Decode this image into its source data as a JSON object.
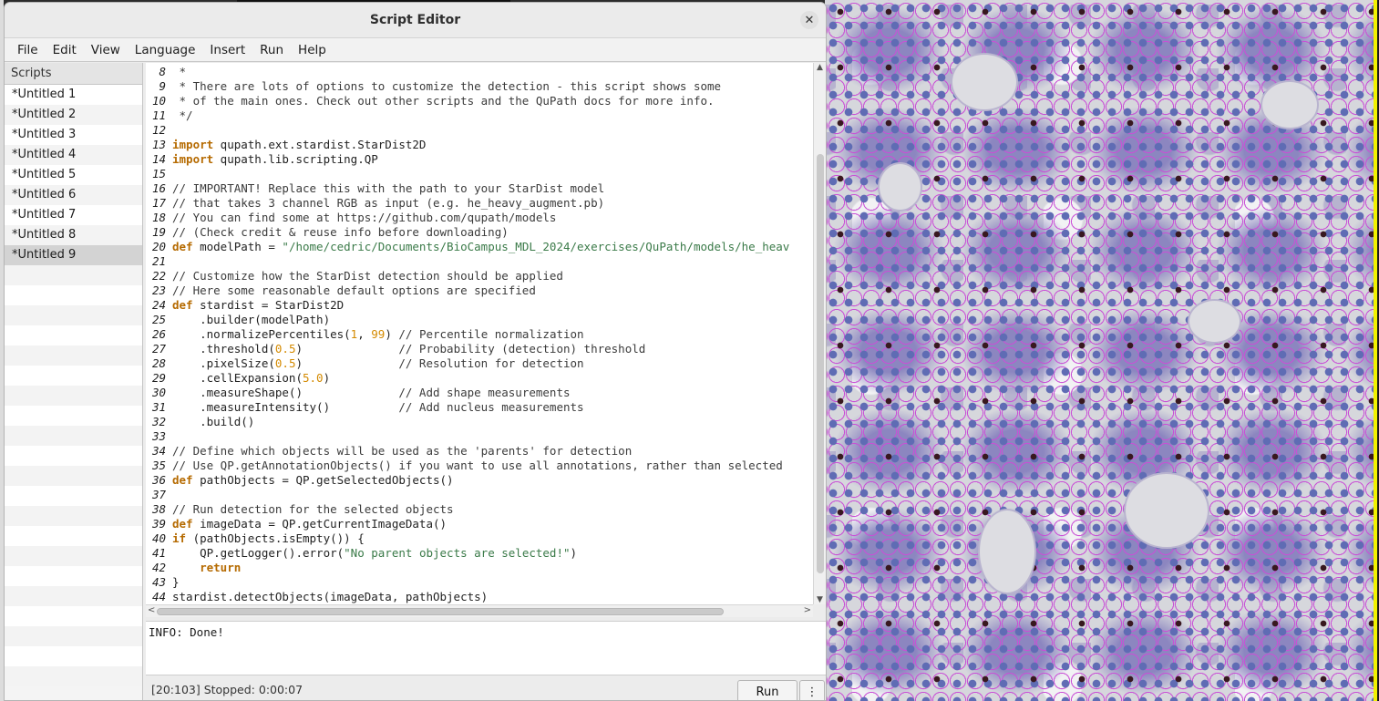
{
  "window": {
    "title": "Script Editor",
    "close_glyph": "✕"
  },
  "menu": [
    "File",
    "Edit",
    "View",
    "Language",
    "Insert",
    "Run",
    "Help"
  ],
  "scripts_panel": {
    "header": "Scripts",
    "items": [
      "*Untitled 1",
      "*Untitled 2",
      "*Untitled 3",
      "*Untitled 4",
      "*Untitled 5",
      "*Untitled 6",
      "*Untitled 7",
      "*Untitled 8",
      "*Untitled 9"
    ],
    "selected": "*Untitled 9"
  },
  "editor": {
    "lines": [
      {
        "n": "8",
        "parts": [
          [
            "cm",
            " *"
          ]
        ]
      },
      {
        "n": "9",
        "parts": [
          [
            "cm",
            " * There are lots of options to customize the detection - this script shows some"
          ]
        ]
      },
      {
        "n": "10",
        "parts": [
          [
            "cm",
            " * of the main ones. Check out other scripts and the QuPath docs for more info."
          ]
        ]
      },
      {
        "n": "11",
        "parts": [
          [
            "cm",
            " */"
          ]
        ]
      },
      {
        "n": "12",
        "parts": []
      },
      {
        "n": "13",
        "parts": [
          [
            "kw",
            "import"
          ],
          [
            "",
            " qupath.ext.stardist.StarDist2D"
          ]
        ]
      },
      {
        "n": "14",
        "parts": [
          [
            "kw",
            "import"
          ],
          [
            "",
            " qupath.lib.scripting.QP"
          ]
        ]
      },
      {
        "n": "15",
        "parts": []
      },
      {
        "n": "16",
        "parts": [
          [
            "cm",
            "// IMPORTANT! Replace this with the path to your StarDist model"
          ]
        ]
      },
      {
        "n": "17",
        "parts": [
          [
            "cm",
            "// that takes 3 channel RGB as input (e.g. he_heavy_augment.pb)"
          ]
        ]
      },
      {
        "n": "18",
        "parts": [
          [
            "cm",
            "// You can find some at https://github.com/qupath/models"
          ]
        ]
      },
      {
        "n": "19",
        "parts": [
          [
            "cm",
            "// (Check credit & reuse info before downloading)"
          ]
        ]
      },
      {
        "n": "20",
        "parts": [
          [
            "kw",
            "def"
          ],
          [
            "",
            " modelPath = "
          ],
          [
            "str",
            "\"/home/cedric/Documents/BioCampus_MDL_2024/exercises/QuPath/models/he_heav"
          ]
        ]
      },
      {
        "n": "21",
        "parts": []
      },
      {
        "n": "22",
        "parts": [
          [
            "cm",
            "// Customize how the StarDist detection should be applied"
          ]
        ]
      },
      {
        "n": "23",
        "parts": [
          [
            "cm",
            "// Here some reasonable default options are specified"
          ]
        ]
      },
      {
        "n": "24",
        "parts": [
          [
            "kw",
            "def"
          ],
          [
            "",
            " stardist = StarDist2D"
          ]
        ]
      },
      {
        "n": "25",
        "parts": [
          [
            "",
            "    .builder(modelPath)"
          ]
        ]
      },
      {
        "n": "26",
        "parts": [
          [
            "",
            "    .normalizePercentiles("
          ],
          [
            "num",
            "1"
          ],
          [
            "",
            ", "
          ],
          [
            "num",
            "99"
          ],
          [
            "",
            ") "
          ],
          [
            "cm",
            "// Percentile normalization"
          ]
        ]
      },
      {
        "n": "27",
        "parts": [
          [
            "",
            "    .threshold("
          ],
          [
            "num",
            "0.5"
          ],
          [
            "",
            ")              "
          ],
          [
            "cm",
            "// Probability (detection) threshold"
          ]
        ]
      },
      {
        "n": "28",
        "parts": [
          [
            "",
            "    .pixelSize("
          ],
          [
            "num",
            "0.5"
          ],
          [
            "",
            ")              "
          ],
          [
            "cm",
            "// Resolution for detection"
          ]
        ]
      },
      {
        "n": "29",
        "parts": [
          [
            "",
            "    .cellExpansion("
          ],
          [
            "num",
            "5.0"
          ],
          [
            "",
            ")"
          ]
        ]
      },
      {
        "n": "30",
        "parts": [
          [
            "",
            "    .measureShape()              "
          ],
          [
            "cm",
            "// Add shape measurements"
          ]
        ]
      },
      {
        "n": "31",
        "parts": [
          [
            "",
            "    .measureIntensity()          "
          ],
          [
            "cm",
            "// Add nucleus measurements"
          ]
        ]
      },
      {
        "n": "32",
        "parts": [
          [
            "",
            "    .build()"
          ]
        ]
      },
      {
        "n": "33",
        "parts": []
      },
      {
        "n": "34",
        "parts": [
          [
            "cm",
            "// Define which objects will be used as the 'parents' for detection"
          ]
        ]
      },
      {
        "n": "35",
        "parts": [
          [
            "cm",
            "// Use QP.getAnnotationObjects() if you want to use all annotations, rather than selected"
          ]
        ]
      },
      {
        "n": "36",
        "parts": [
          [
            "kw",
            "def"
          ],
          [
            "",
            " pathObjects = QP.getSelectedObjects()"
          ]
        ]
      },
      {
        "n": "37",
        "parts": []
      },
      {
        "n": "38",
        "parts": [
          [
            "cm",
            "// Run detection for the selected objects"
          ]
        ]
      },
      {
        "n": "39",
        "parts": [
          [
            "kw",
            "def"
          ],
          [
            "",
            " imageData = QP.getCurrentImageData()"
          ]
        ]
      },
      {
        "n": "40",
        "parts": [
          [
            "kw",
            "if"
          ],
          [
            "",
            " (pathObjects.isEmpty()) {"
          ]
        ]
      },
      {
        "n": "41",
        "parts": [
          [
            "",
            "    QP.getLogger().error("
          ],
          [
            "str",
            "\"No parent objects are selected!\""
          ],
          [
            "",
            ")"
          ]
        ]
      },
      {
        "n": "42",
        "parts": [
          [
            "",
            "    "
          ],
          [
            "kw",
            "return"
          ]
        ]
      },
      {
        "n": "43",
        "parts": [
          [
            "",
            "}"
          ]
        ]
      },
      {
        "n": "44",
        "parts": [
          [
            "",
            "stardist.detectObjects(imageData, pathObjects)"
          ]
        ]
      }
    ]
  },
  "console": {
    "text": "INFO: Done!"
  },
  "status": {
    "text": "[20:103]  Stopped: 0:00:07",
    "run_label": "Run",
    "run_options_glyph": "⋮"
  },
  "icons": {
    "scroll_up": "▲",
    "scroll_down": "▼",
    "scroll_left": "<",
    "scroll_right": ">"
  }
}
